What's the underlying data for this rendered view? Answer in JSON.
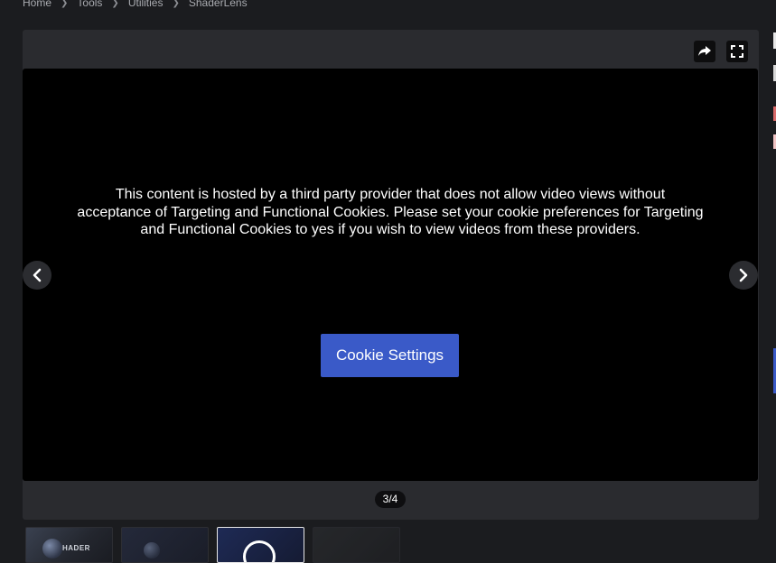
{
  "breadcrumb": {
    "items": [
      "Home",
      "Tools",
      "Utilities",
      "ShaderLens"
    ]
  },
  "gallery": {
    "consent_message": "This content is hosted by a third party provider that does not allow video views without acceptance of Targeting and Functional Cookies. Please set your cookie preferences for Targeting and Functional Cookies to yes if you wish to view videos from these providers.",
    "cookie_button_label": "Cookie Settings",
    "counter": "3/4",
    "current_slide": 3,
    "total_slides": 4
  },
  "thumbnails": [
    {
      "label": "HADER",
      "active": false
    },
    {
      "label": "",
      "active": false
    },
    {
      "label": "",
      "active": true
    },
    {
      "label": "",
      "active": false
    }
  ],
  "colors": {
    "page_background": "#1b1c1f",
    "panel_background": "#2a2b2f",
    "accent_button": "#3a5ac8",
    "viewer_background": "#000000"
  },
  "icons": {
    "share": "share-arrow-icon",
    "fullscreen": "fullscreen-icon",
    "prev": "chevron-left-icon",
    "next": "chevron-right-icon",
    "breadcrumb_separator": "chevron-right-small-icon"
  }
}
